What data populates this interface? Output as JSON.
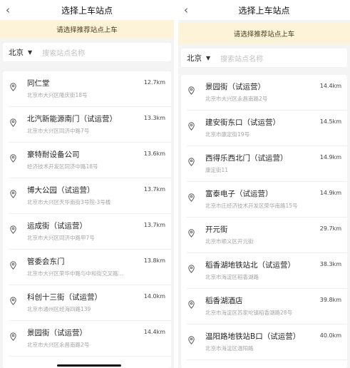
{
  "left": {
    "nav": {
      "back_icon": "chevron-left-icon",
      "title": "选择上车站点"
    },
    "banner": "请选择推荐站点上车",
    "search": {
      "city": "北京",
      "placeholder": "搜索站点名称"
    },
    "stations": [
      {
        "name": "同仁堂",
        "address": "北京市大兴区隆庆街18号",
        "distance": "12.7km"
      },
      {
        "name": "北汽新能源南门（试运营）",
        "address": "北京市大兴区同济中路7号",
        "distance": "13.3km"
      },
      {
        "name": "豪特耐设备公司",
        "address": "经济技术开发区同济中路18号",
        "distance": "13.6km"
      },
      {
        "name": "博大公园（试运营）",
        "address": "北京市大兴区天华南街3号院-3号楼",
        "distance": "13.7km"
      },
      {
        "name": "运成街（试运营）",
        "address": "北京市大兴区同济中路甲7号",
        "distance": "13.7km"
      },
      {
        "name": "管委会东门",
        "address": "北京市大兴区荣华中路与中和街交叉路...",
        "distance": "13.8km"
      },
      {
        "name": "科创十三街（试运营）",
        "address": "北京市通州区经海四路139",
        "distance": "14.0km"
      },
      {
        "name": "景园街（试运营）",
        "address": "北京市大兴区永昌南路2号",
        "distance": "14.4km"
      }
    ]
  },
  "right": {
    "nav": {
      "back_icon": "chevron-left-icon",
      "title": "选择上车站点"
    },
    "banner": "请选择推荐站点上车",
    "search": {
      "city": "北京",
      "placeholder": "搜索站点名称"
    },
    "stations": [
      {
        "name": "景园街（试运营）",
        "address": "北京市大兴区永昌南路2号",
        "distance": "14.4km"
      },
      {
        "name": "建安街东口（试运营）",
        "address": "北京市康定街19号",
        "distance": "14.5km"
      },
      {
        "name": "西得乐西北门（试运营）",
        "address": "康定街11",
        "distance": "14.9km"
      },
      {
        "name": "富泰电子（试运营）",
        "address": "北京市庄经济技术开发区荣华南路15号",
        "distance": "14.9km"
      },
      {
        "name": "开元街",
        "address": "北京市顺义区开元街",
        "distance": "29.7km"
      },
      {
        "name": "稻香湖地铁站北（试运营）",
        "address": "北京市海淀区稻香湖路",
        "distance": "38.3km"
      },
      {
        "name": "稻香湖酒店",
        "address": "北京市海淀区苏家坨镇稻香湖路28号",
        "distance": "39.8km"
      },
      {
        "name": "温阳路地铁站B口（试运营）",
        "address": "北京市海淀区温阳路",
        "distance": "40.0km"
      }
    ]
  },
  "icons": {
    "caret": "caret-down-icon",
    "location": "location-pin-icon"
  }
}
